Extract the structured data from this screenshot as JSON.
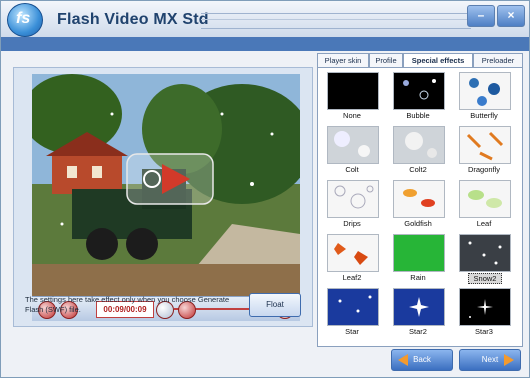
{
  "window": {
    "title": "Flash Video MX Std",
    "minimize_glyph": "–",
    "close_glyph": "×"
  },
  "player": {
    "time": "00:09/00:09",
    "icons": [
      "play-icon",
      "stop-icon",
      "fullscreen-icon",
      "volume-icon",
      "seek-thumb-icon"
    ]
  },
  "notice_text": "The settings here take effect only when you choose Generate Flash (SWF) file.",
  "float_button": "Float",
  "tabs": [
    {
      "label": "Player skin"
    },
    {
      "label": "Profile"
    },
    {
      "label": "Special effects"
    },
    {
      "label": "Preloader"
    }
  ],
  "effects": [
    {
      "label": "None"
    },
    {
      "label": "Bubble"
    },
    {
      "label": "Butterfly"
    },
    {
      "label": "Colt"
    },
    {
      "label": "Colt2"
    },
    {
      "label": "Dragonfly"
    },
    {
      "label": "Drips"
    },
    {
      "label": "Goldfish"
    },
    {
      "label": "Leaf"
    },
    {
      "label": "Leaf2"
    },
    {
      "label": "Rain"
    },
    {
      "label": "Snow2"
    },
    {
      "label": "Star"
    },
    {
      "label": "Star2"
    },
    {
      "label": "Star3"
    }
  ],
  "nav": {
    "back": "Back",
    "next": "Next"
  },
  "colors": {
    "accent": "#3b6fc0",
    "arrow": "#f39a2e",
    "player_red": "#c03232"
  }
}
